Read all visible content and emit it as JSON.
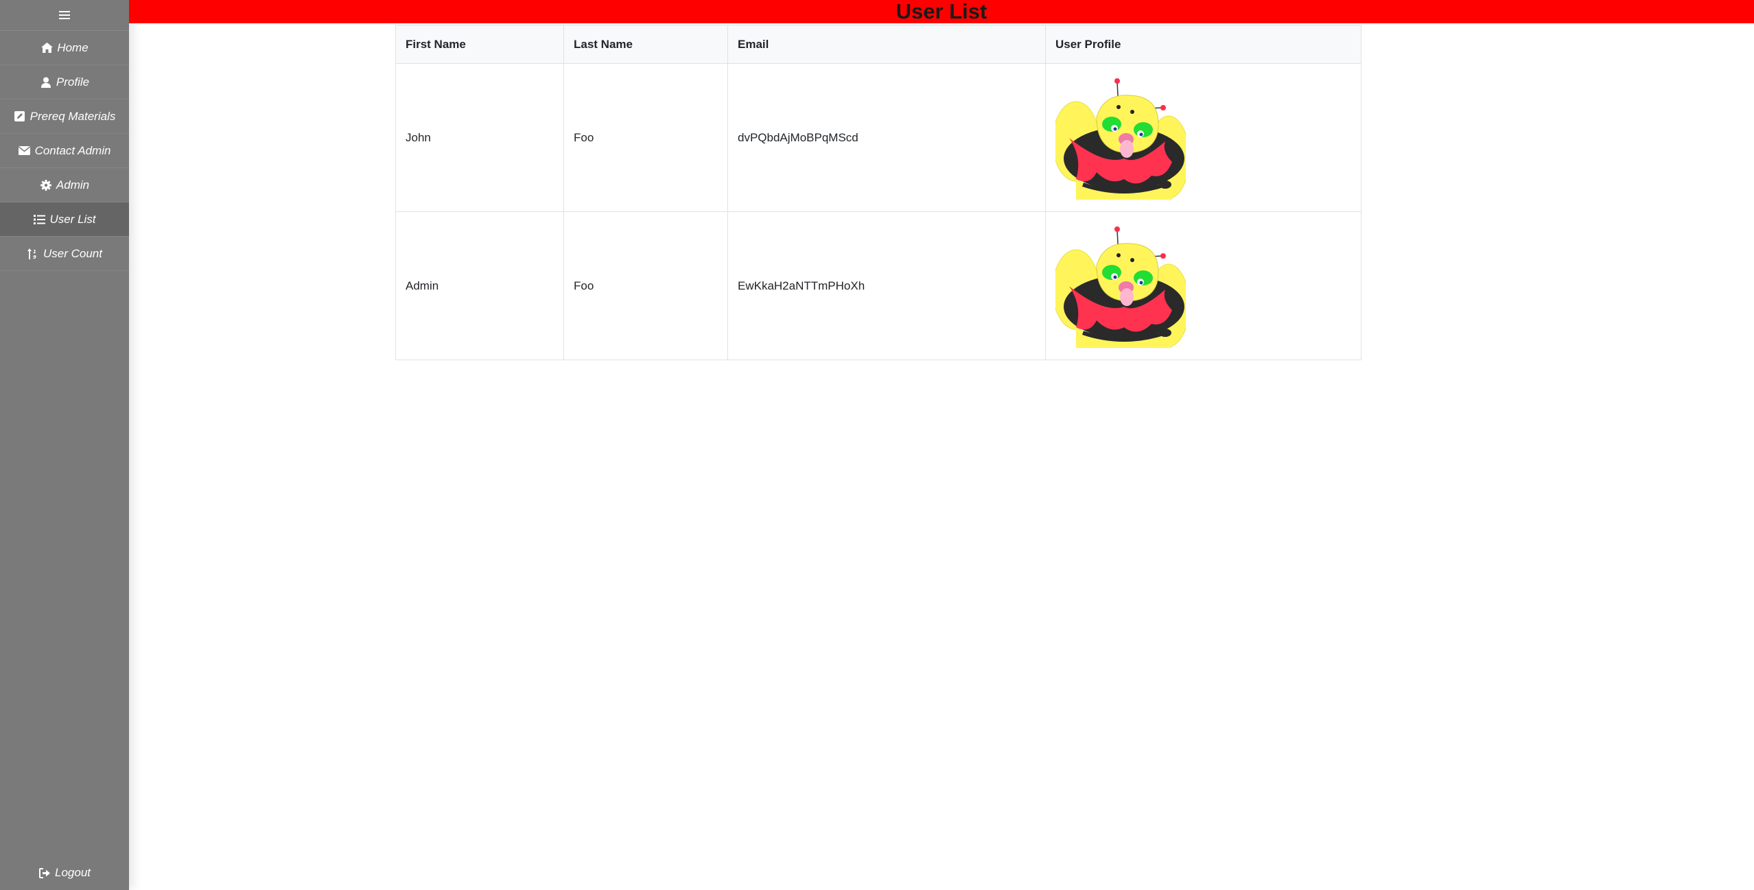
{
  "sidebar": {
    "menu_icon": "hamburger-menu-icon",
    "items": [
      {
        "label": "Home",
        "icon": "home-icon"
      },
      {
        "label": "Profile",
        "icon": "user-icon"
      },
      {
        "label": "Prereq Materials",
        "icon": "edit-square-icon"
      },
      {
        "label": "Contact Admin",
        "icon": "envelope-icon"
      },
      {
        "label": "Admin",
        "icon": "gear-icon"
      },
      {
        "label": "User List",
        "icon": "list-icon",
        "active": true
      },
      {
        "label": "User Count",
        "icon": "sort-numeric-icon"
      }
    ],
    "logout": {
      "label": "Logout",
      "icon": "sign-out-icon"
    }
  },
  "header": {
    "title": "User List",
    "background": "#ff0000"
  },
  "table": {
    "columns": [
      "First Name",
      "Last Name",
      "Email",
      "User Profile"
    ],
    "rows": [
      {
        "first_name": "John",
        "last_name": "Foo",
        "email": "dvPQbdAjMoBPqMScd",
        "profile_image": "cartoon-bee-avatar"
      },
      {
        "first_name": "Admin",
        "last_name": "Foo",
        "email": "EwKkaH2aNTTmPHoXh",
        "profile_image": "cartoon-bee-avatar"
      }
    ]
  },
  "colors": {
    "sidebar_bg": "#7a7a7a",
    "sidebar_active": "#656565",
    "header_bg": "#ff0000"
  }
}
